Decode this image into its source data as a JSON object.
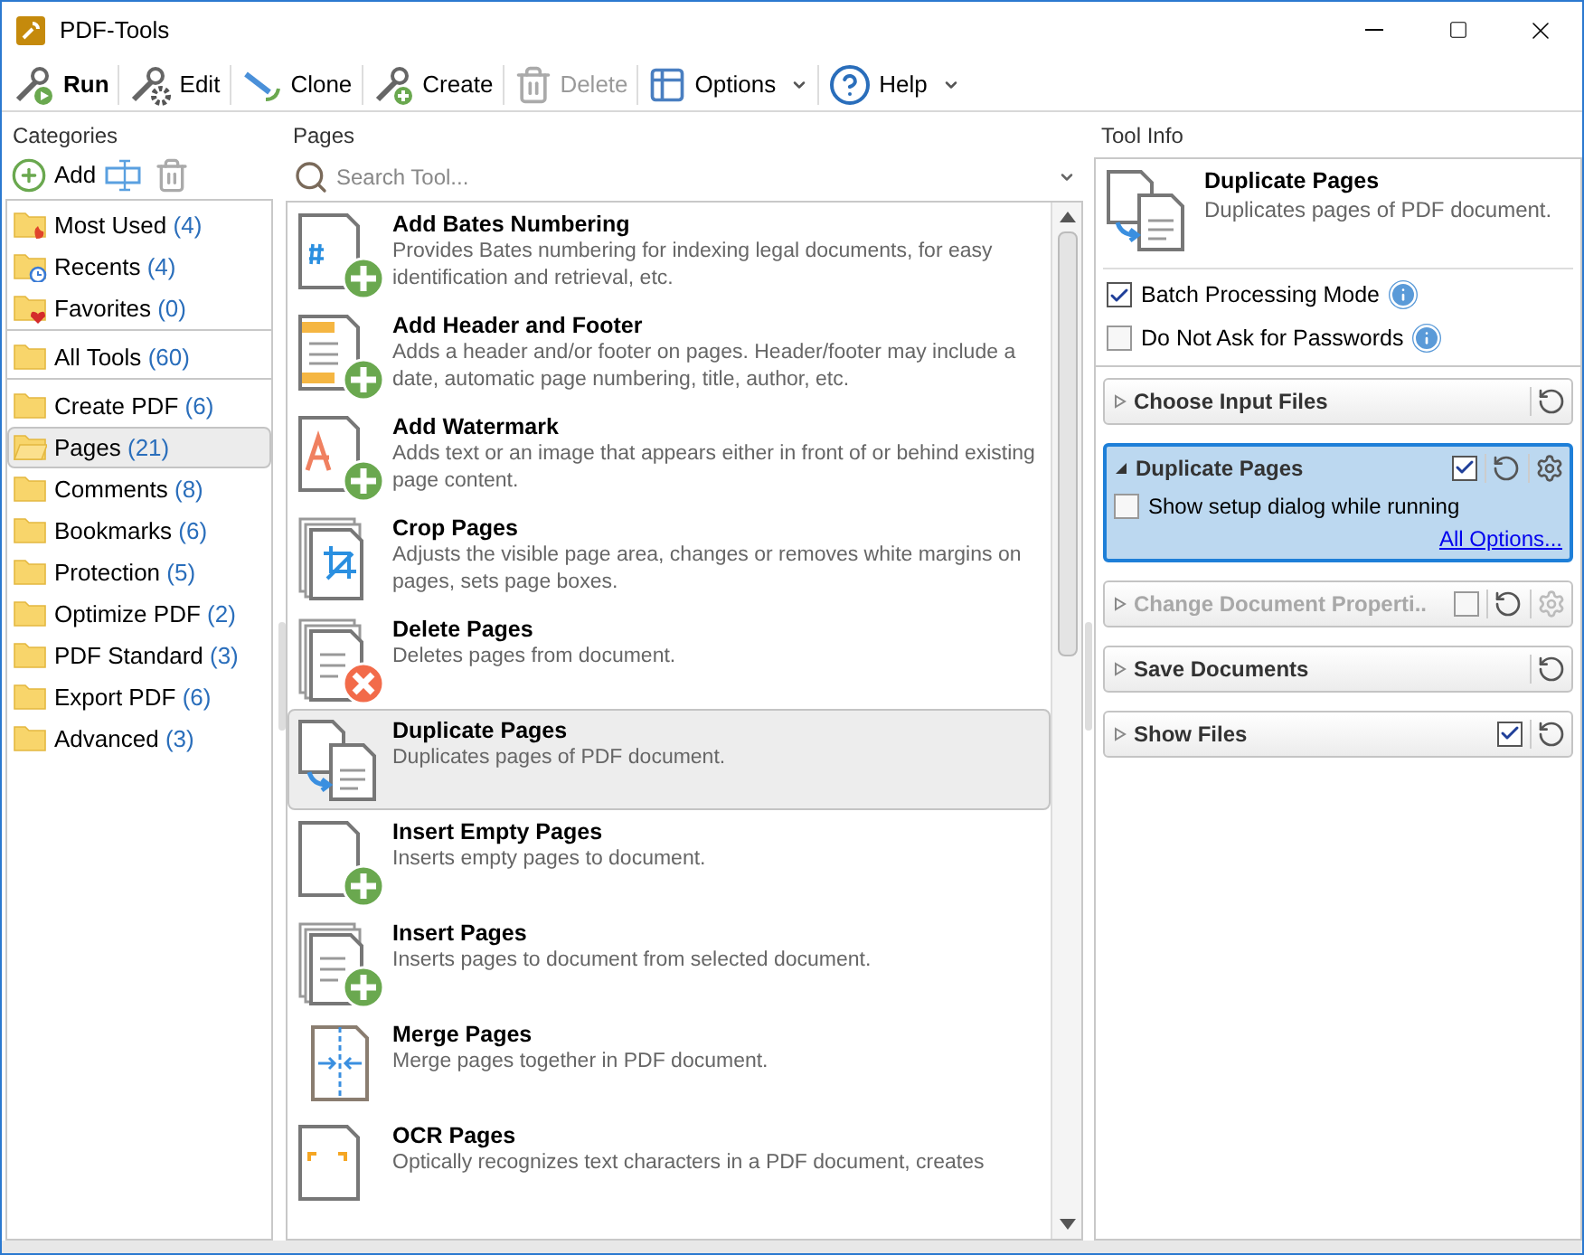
{
  "window": {
    "title": "PDF-Tools"
  },
  "toolbar": [
    {
      "label": "Run",
      "kind": "run",
      "bold": true,
      "disabled": false,
      "dropdown": false
    },
    {
      "label": "Edit",
      "kind": "edit",
      "bold": false,
      "disabled": false,
      "dropdown": false
    },
    {
      "label": "Clone",
      "kind": "clone",
      "bold": false,
      "disabled": false,
      "dropdown": false
    },
    {
      "label": "Create",
      "kind": "create",
      "bold": false,
      "disabled": false,
      "dropdown": false
    },
    {
      "label": "Delete",
      "kind": "delete",
      "bold": false,
      "disabled": true,
      "dropdown": false
    },
    {
      "label": "Options",
      "kind": "options",
      "bold": false,
      "disabled": false,
      "dropdown": true
    },
    {
      "label": "Help",
      "kind": "help",
      "bold": false,
      "disabled": false,
      "dropdown": true
    }
  ],
  "categories": {
    "title": "Categories",
    "add_label": "Add",
    "groups": [
      [
        {
          "name": "Most Used",
          "count": "(4)",
          "kind": "flame",
          "selected": false
        },
        {
          "name": "Recents",
          "count": "(4)",
          "kind": "clock",
          "selected": false
        },
        {
          "name": "Favorites",
          "count": "(0)",
          "kind": "heart",
          "selected": false
        }
      ],
      [
        {
          "name": "All Tools",
          "count": "(60)",
          "kind": "folder",
          "selected": false
        }
      ],
      [
        {
          "name": "Create PDF",
          "count": "(6)",
          "kind": "folder",
          "selected": false
        },
        {
          "name": "Pages",
          "count": "(21)",
          "kind": "open",
          "selected": true
        },
        {
          "name": "Comments",
          "count": "(8)",
          "kind": "folder",
          "selected": false
        },
        {
          "name": "Bookmarks",
          "count": "(6)",
          "kind": "folder",
          "selected": false
        },
        {
          "name": "Protection",
          "count": "(5)",
          "kind": "folder",
          "selected": false
        },
        {
          "name": "Optimize PDF",
          "count": "(2)",
          "kind": "folder",
          "selected": false
        },
        {
          "name": "PDF Standard",
          "count": "(3)",
          "kind": "folder",
          "selected": false
        },
        {
          "name": "Export PDF",
          "count": "(6)",
          "kind": "folder",
          "selected": false
        },
        {
          "name": "Advanced",
          "count": "(3)",
          "kind": "folder",
          "selected": false
        }
      ]
    ]
  },
  "pages": {
    "title": "Pages",
    "search": {
      "placeholder": "Search Tool..."
    },
    "tools": [
      {
        "title": "Add Bates Numbering",
        "description": "Provides Bates numbering for indexing legal documents, for easy identification and retrieval, etc.",
        "kind": "bates",
        "selected": false
      },
      {
        "title": "Add Header and Footer",
        "description": "Adds a header and/or footer on pages. Header/footer may include a date, automatic page numbering, title, author, etc.",
        "kind": "header",
        "selected": false
      },
      {
        "title": "Add Watermark",
        "description": "Adds text or an image that appears either in front of or behind existing page content.",
        "kind": "watermark",
        "selected": false
      },
      {
        "title": "Crop Pages",
        "description": "Adjusts the visible page area, changes or removes white margins on pages, sets page boxes.",
        "kind": "crop",
        "selected": false
      },
      {
        "title": "Delete Pages",
        "description": "Deletes pages from document.",
        "kind": "delete",
        "selected": false
      },
      {
        "title": "Duplicate Pages",
        "description": "Duplicates pages of PDF document.",
        "kind": "duplicate",
        "selected": true
      },
      {
        "title": "Insert Empty Pages",
        "description": "Inserts empty pages to document.",
        "kind": "empty",
        "selected": false
      },
      {
        "title": "Insert Pages",
        "description": "Inserts pages to document from selected document.",
        "kind": "insert",
        "selected": false
      },
      {
        "title": "Merge Pages",
        "description": "Merge pages together in PDF document.",
        "kind": "merge",
        "selected": false
      },
      {
        "title": "OCR Pages",
        "description": "Optically recognizes text characters in a PDF document, creates",
        "kind": "ocr",
        "selected": false
      }
    ]
  },
  "tool_info": {
    "title": "Tool Info",
    "tool_title": "Duplicate Pages",
    "tool_description": "Duplicates pages of PDF document.",
    "options": [
      {
        "label": "Batch Processing Mode",
        "checked": true
      },
      {
        "label": "Do Not Ask for Passwords",
        "checked": false
      }
    ],
    "steps": [
      {
        "title": "Choose Input Files",
        "kind": "plain",
        "expanded": false,
        "disabled": false
      },
      {
        "title": "Duplicate Pages",
        "kind": "configurable",
        "expanded": true,
        "disabled": false,
        "checked": true,
        "option": {
          "label": "Show setup dialog while running",
          "checked": false
        },
        "link": "All Options..."
      },
      {
        "title": "Change Document Properti..",
        "kind": "configurable",
        "expanded": false,
        "disabled": true,
        "checked": false
      },
      {
        "title": "Save Documents",
        "kind": "plain",
        "expanded": false,
        "disabled": false
      },
      {
        "title": "Show Files",
        "kind": "toggle",
        "expanded": false,
        "disabled": false,
        "checked": true
      }
    ]
  }
}
